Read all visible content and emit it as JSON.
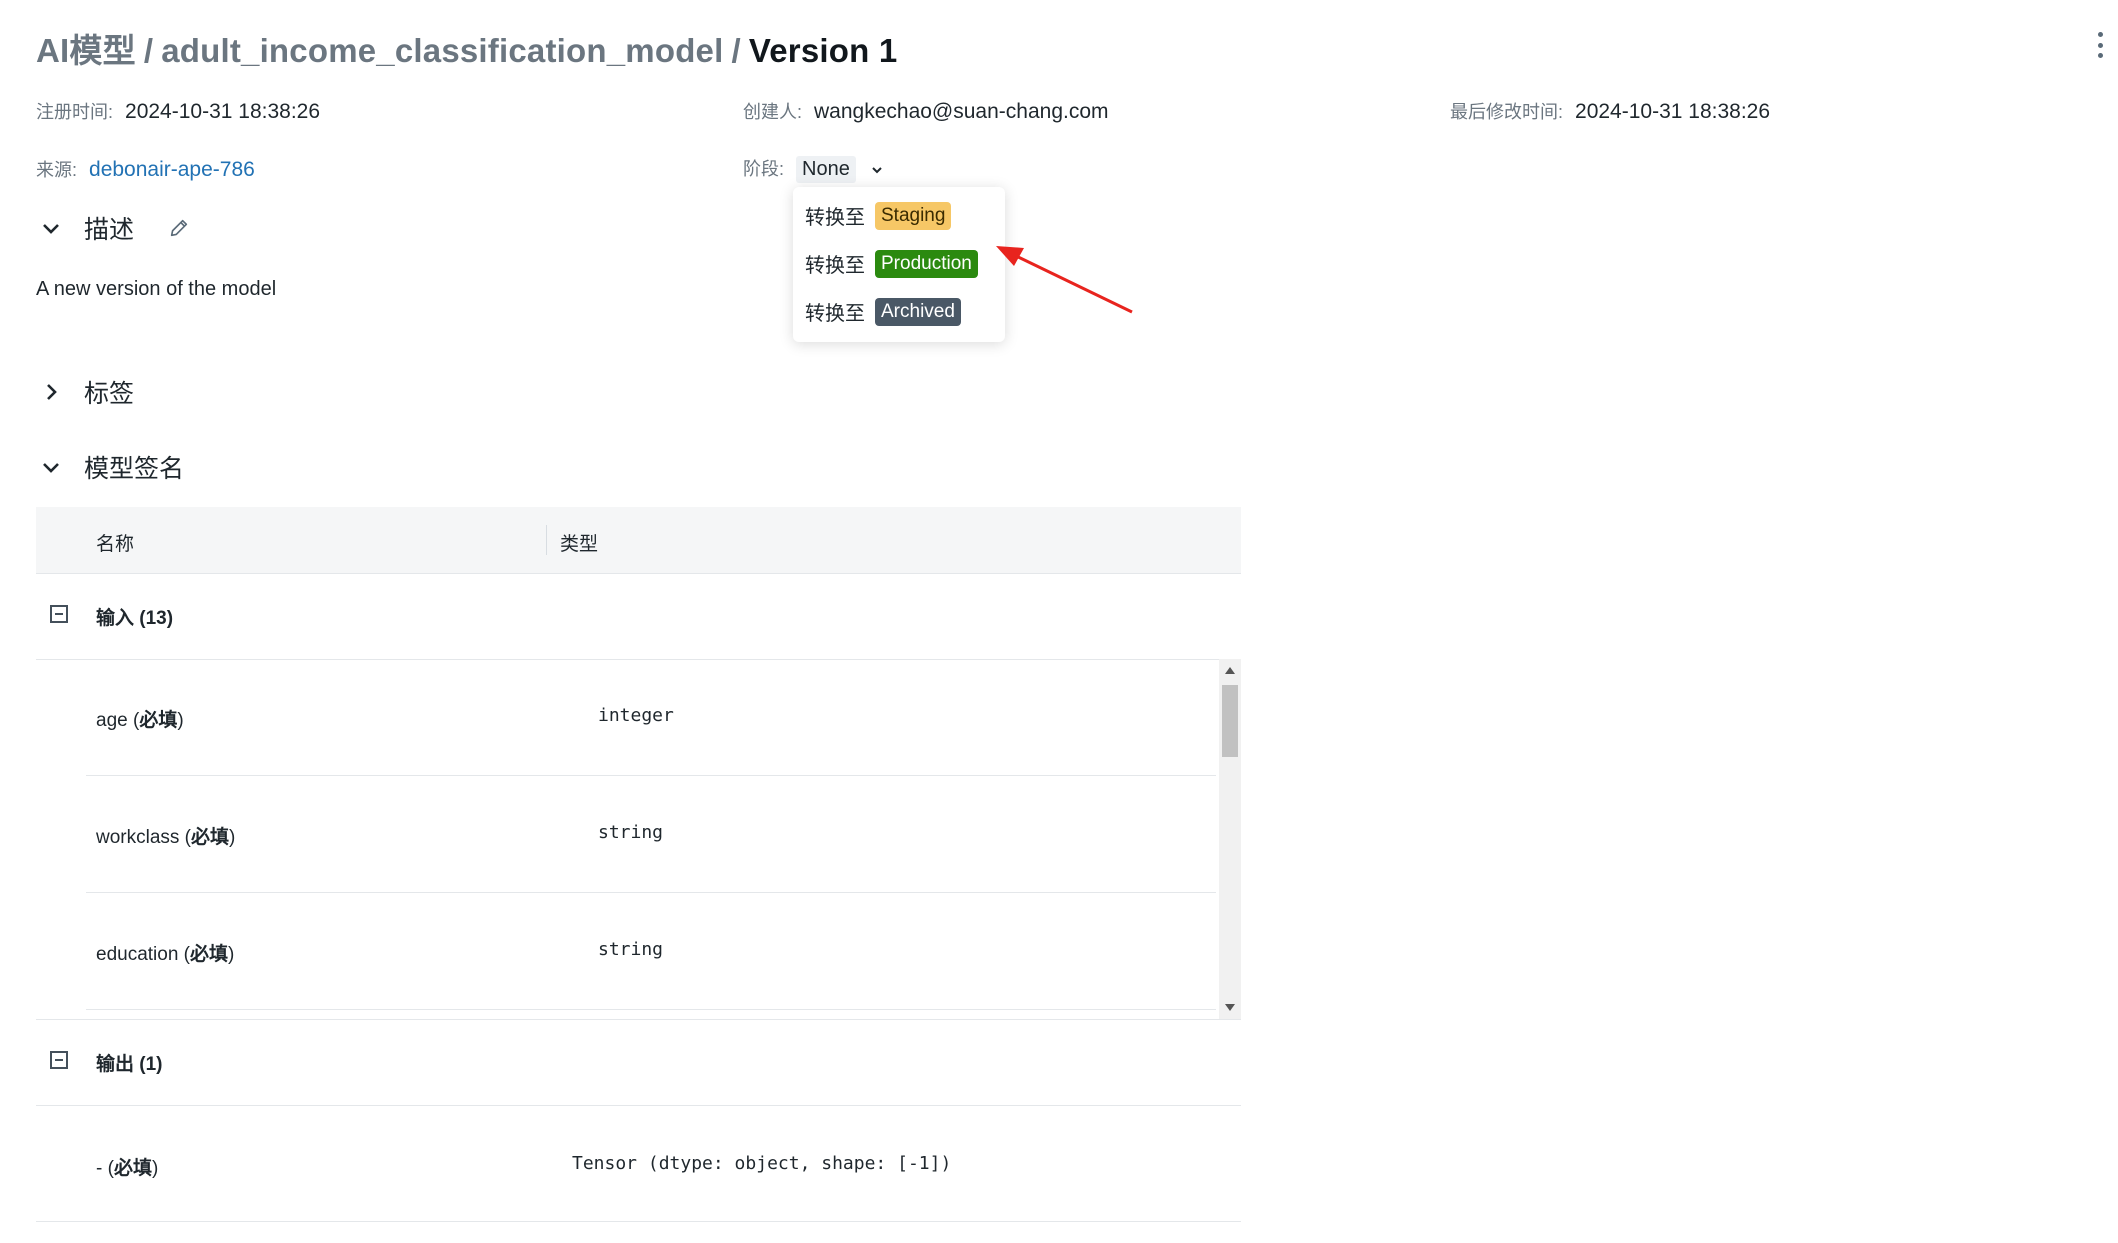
{
  "breadcrumb": {
    "root": "AI模型",
    "model": "adult_income_classification_model",
    "version": "Version 1",
    "separator": "/"
  },
  "meta": {
    "registered_label": "注册时间:",
    "registered_value": "2024-10-31 18:38:26",
    "creator_label": "创建人:",
    "creator_value": "wangkechao@suan-chang.com",
    "modified_label": "最后修改时间:",
    "modified_value": "2024-10-31 18:38:26",
    "source_label": "来源:",
    "source_value": "debonair-ape-786",
    "stage_label": "阶段:",
    "stage_value": "None"
  },
  "stage_menu": {
    "items": [
      {
        "prefix": "转换至",
        "stage": "Staging",
        "color": "#f6c766"
      },
      {
        "prefix": "转换至",
        "stage": "Production",
        "color": "#2b8a0f"
      },
      {
        "prefix": "转换至",
        "stage": "Archived",
        "color": "#4a5866"
      }
    ]
  },
  "sections": {
    "description_title": "描述",
    "description_text": "A new version of the model",
    "tags_title": "标签",
    "signature_title": "模型签名"
  },
  "signature": {
    "col_name": "名称",
    "col_type": "类型",
    "inputs_label": "输入 (13)",
    "outputs_label": "输出 (1)",
    "required_text": "必填",
    "inputs": [
      {
        "name": "age",
        "type": "integer"
      },
      {
        "name": "workclass",
        "type": "string"
      },
      {
        "name": "education",
        "type": "string"
      }
    ],
    "outputs": [
      {
        "name": "-",
        "type": "Tensor (dtype: object, shape: [-1])"
      }
    ]
  },
  "icons": {
    "annotation_arrow_color": "#e8241e",
    "link_color": "#2272b4"
  }
}
